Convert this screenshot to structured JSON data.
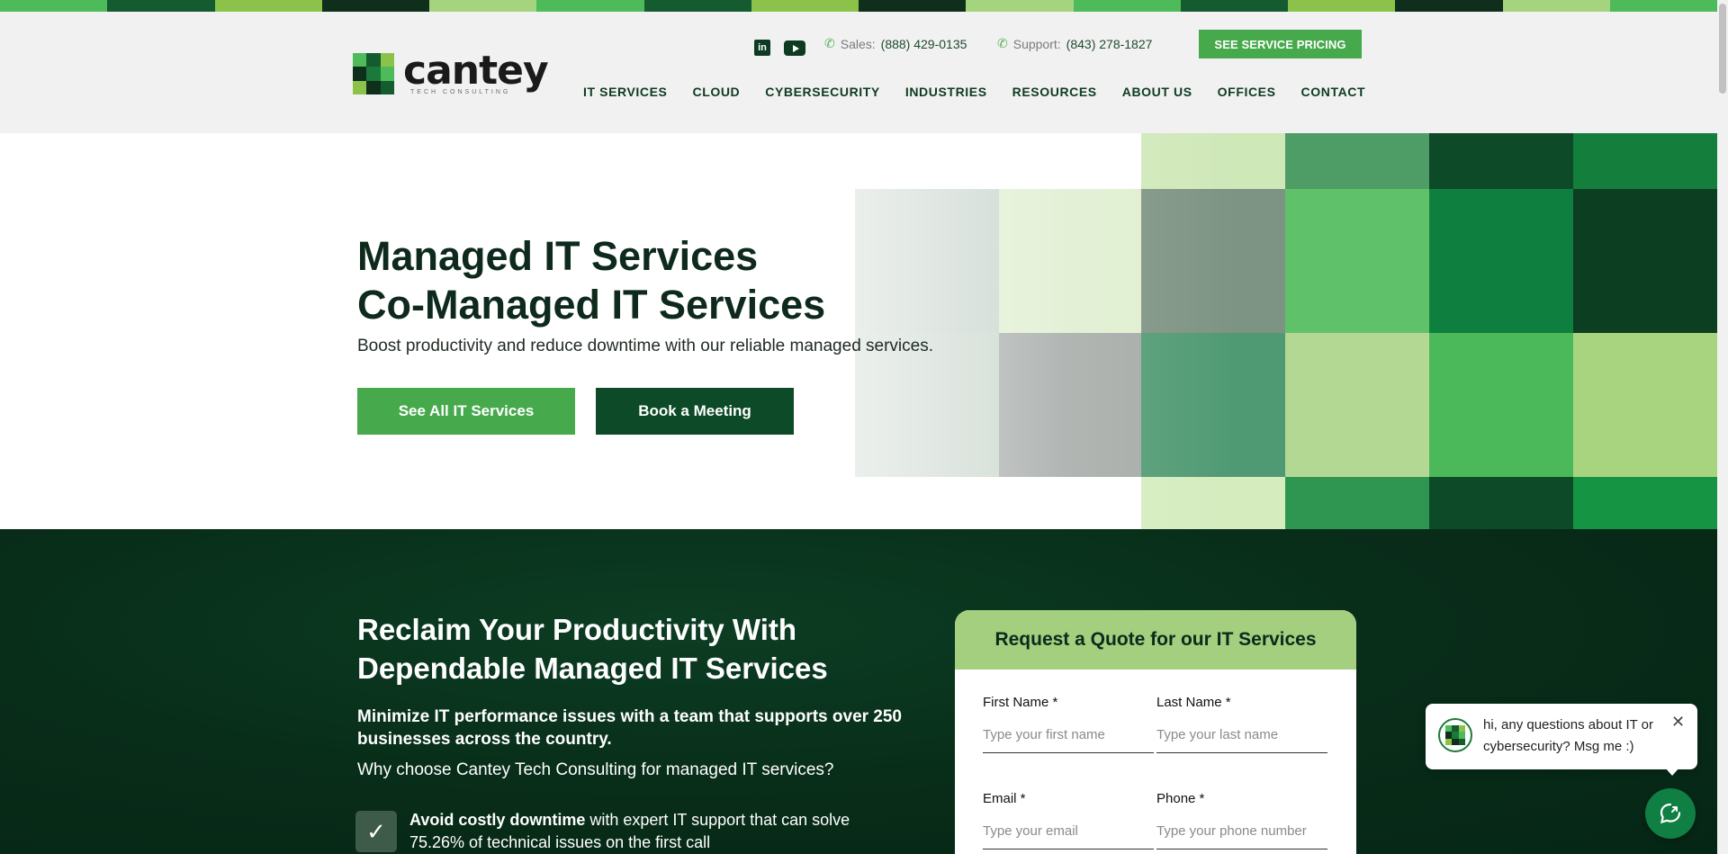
{
  "colors": {
    "brand_dark": "#0d4a27",
    "brand_green": "#46a94c",
    "light_green": "#a3cf7f",
    "section_dark": "#082d19",
    "stripe": [
      "#4dbb5a",
      "#145c30",
      "#8bc34a",
      "#0f2e1c",
      "#a5d47f",
      "#4dbb5a",
      "#145c30",
      "#8bc34a",
      "#0f2e1c",
      "#a5d47f",
      "#4dbb5a",
      "#145c30",
      "#8bc34a",
      "#0f2e1c",
      "#a5d47f",
      "#4dbb5a"
    ]
  },
  "header": {
    "logo": {
      "word": "cantey",
      "sub": "TECH CONSULTING"
    },
    "social": {
      "linkedin_icon": "in",
      "youtube_icon": "youtube-icon"
    },
    "sales": {
      "label": "Sales:",
      "number": "(888) 429-0135"
    },
    "support": {
      "label": "Support:",
      "number": "(843) 278-1827"
    },
    "pricing_button": "SEE SERVICE PRICING",
    "nav": [
      "IT SERVICES",
      "CLOUD",
      "CYBERSECURITY",
      "INDUSTRIES",
      "RESOURCES",
      "ABOUT US",
      "OFFICES",
      "CONTACT"
    ]
  },
  "hero": {
    "title_line1": "Managed IT Services",
    "title_line2": "Co-Managed IT Services",
    "subtitle": "Boost productivity and reduce downtime with our reliable managed services.",
    "primary_button": "See All IT Services",
    "secondary_button": "Book a Meeting"
  },
  "section": {
    "title_line1": "Reclaim Your Productivity With",
    "title_line2": "Dependable Managed IT Services",
    "bold_text": "Minimize IT performance issues with a team that supports over 250 businesses across the country.",
    "question": "Why choose Cantey Tech Consulting for managed IT services?",
    "check_item": {
      "bold": "Avoid costly downtime",
      "rest": " with expert IT support that can solve 75.26% of technical issues on the first call"
    }
  },
  "quote_form": {
    "title": "Request a Quote for our IT Services",
    "first_name": {
      "label": "First Name *",
      "placeholder": "Type your first name"
    },
    "last_name": {
      "label": "Last Name *",
      "placeholder": "Type your last name"
    },
    "email": {
      "label": "Email *",
      "placeholder": "Type your email"
    },
    "phone": {
      "label": "Phone *",
      "placeholder": "Type your phone number"
    }
  },
  "chat": {
    "message": "hi, any questions about IT or cybersecurity? Msg me :)",
    "close": "✕"
  }
}
